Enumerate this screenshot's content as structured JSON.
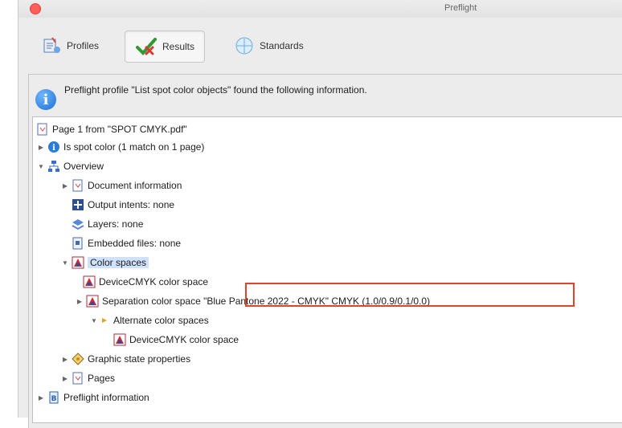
{
  "window": {
    "title": "Preflight"
  },
  "tabs": [
    {
      "label": "Profiles",
      "icon": "profiles-icon",
      "active": false
    },
    {
      "label": "Results",
      "icon": "checkmark-icon",
      "active": true
    },
    {
      "label": "Standards",
      "icon": "standards-icon",
      "active": false
    }
  ],
  "info": {
    "message": "Preflight profile \"List spot color objects\" found the following information.",
    "icon": "info-icon"
  },
  "tree": {
    "root": "Page 1 from \"SPOT CMYK.pdf\"",
    "spot": "Is spot color (1 match on 1 page)",
    "overview": "Overview",
    "doc_info": "Document information",
    "output_intents": "Output intents: none",
    "layers": "Layers: none",
    "embedded": "Embedded files: none",
    "color_spaces": "Color spaces",
    "device_cmyk": "DeviceCMYK color space",
    "separation": "Separation color space \"Blue Pantone 2022 - CMYK\" CMYK (1.0/0.9/0.1/0.0)",
    "alternate": "Alternate color spaces",
    "device_cmyk_2": "DeviceCMYK color space",
    "graphic_state": "Graphic state properties",
    "pages": "Pages",
    "preflight_info": "Preflight information"
  },
  "colors": {
    "highlight_border": "#e0442b",
    "selection": "#cfe1fb",
    "close_button": "#ff5f57"
  }
}
